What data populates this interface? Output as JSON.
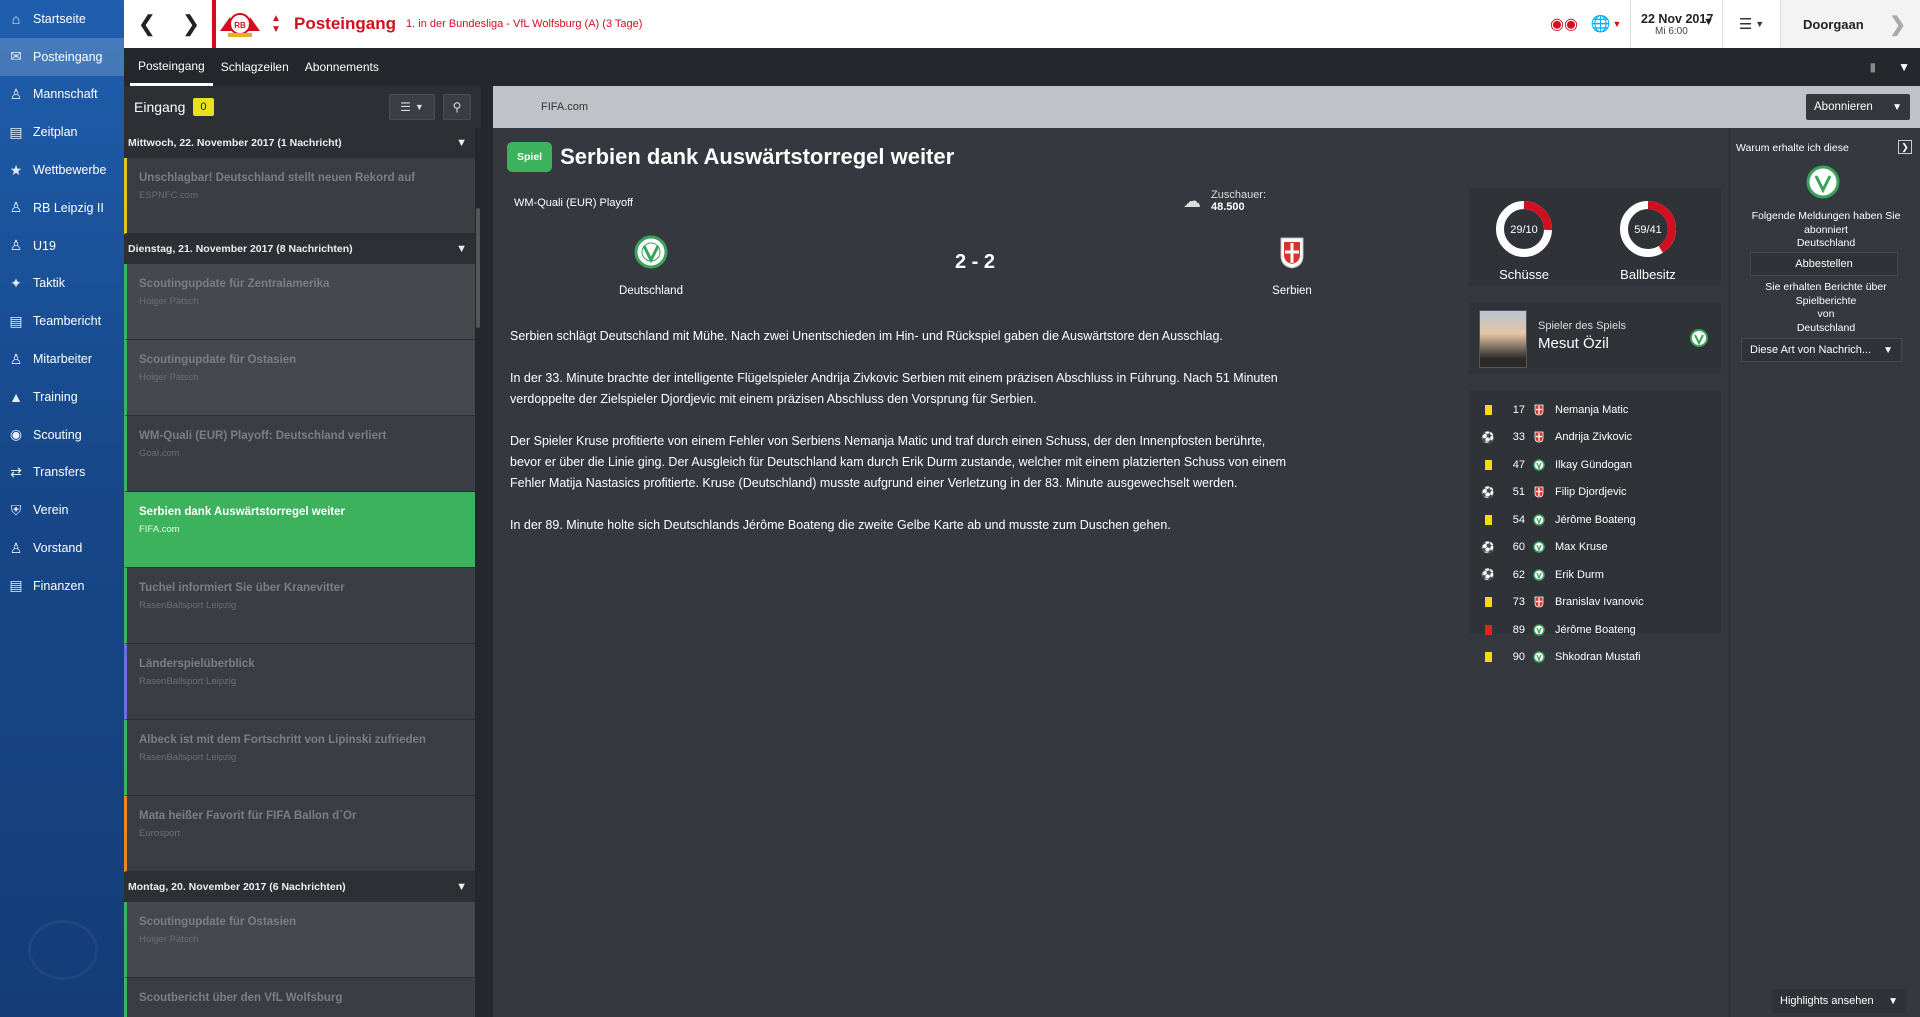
{
  "sidebar": {
    "items": [
      {
        "label": "Startseite",
        "icon": "home-icon"
      },
      {
        "label": "Posteingang",
        "icon": "inbox-icon"
      },
      {
        "label": "Mannschaft",
        "icon": "squad-icon"
      },
      {
        "label": "Zeitplan",
        "icon": "schedule-icon"
      },
      {
        "label": "Wettbewerbe",
        "icon": "trophy-icon"
      },
      {
        "label": "RB Leipzig II",
        "icon": "reserve-team-icon"
      },
      {
        "label": "U19",
        "icon": "youth-team-icon"
      },
      {
        "label": "Taktik",
        "icon": "tactics-icon"
      },
      {
        "label": "Teambericht",
        "icon": "report-icon"
      },
      {
        "label": "Mitarbeiter",
        "icon": "staff-icon"
      },
      {
        "label": "Training",
        "icon": "training-icon"
      },
      {
        "label": "Scouting",
        "icon": "binoculars-icon"
      },
      {
        "label": "Transfers",
        "icon": "transfers-icon"
      },
      {
        "label": "Verein",
        "icon": "club-icon"
      },
      {
        "label": "Vorstand",
        "icon": "board-icon"
      },
      {
        "label": "Finanzen",
        "icon": "finances-icon"
      }
    ]
  },
  "topbar": {
    "title": "Posteingang",
    "next_match": "1. in der Bundesliga - VfL Wolfsburg (A) (3 Tage)",
    "date": "22 Nov 2017",
    "day_time": "Mi 6:00",
    "continue_label": "Doorgaan",
    "accent_color": "#d20f1e"
  },
  "subnav": {
    "tabs": [
      "Posteingang",
      "Schlagzeilen",
      "Abonnements"
    ]
  },
  "inbox": {
    "title": "Eingang",
    "unread_count": "0",
    "groups": [
      {
        "header": "Mittwoch, 22. November 2017 (1 Nachricht)",
        "messages": [
          {
            "title": "Unschlagbar! Deutschland stellt neuen Rekord auf",
            "source": "ESPNFC.com",
            "color": "#e8c21e",
            "lighter": false
          }
        ]
      },
      {
        "header": "Dienstag, 21. November 2017 (8 Nachrichten)",
        "messages": [
          {
            "title": "Scoutingupdate für Zentralamerika",
            "source": "Holger Pätsch",
            "color": "#3bb25b",
            "lighter": true
          },
          {
            "title": "Scoutingupdate für Ostasien",
            "source": "Holger Pätsch",
            "color": "#3bb25b",
            "lighter": true
          },
          {
            "title": "WM-Quali (EUR) Playoff: Deutschland verliert",
            "source": "Goal.com",
            "color": "#3bb25b",
            "lighter": false
          },
          {
            "title": "Serbien dank Auswärtstorregel weiter",
            "source": "FIFA.com",
            "color": "#3bb25b",
            "lighter": false,
            "selected": true
          },
          {
            "title": "Tuchel informiert Sie über Kranevitter",
            "source": "RasenBallsport Leipzig",
            "color": "#3bb25b",
            "lighter": false
          },
          {
            "title": "Länderspielüberblick",
            "source": "RasenBallsport Leipzig",
            "color": "#6a6fd8",
            "lighter": false
          },
          {
            "title": "Albeck ist mit dem Fortschritt von Lipinski zufrieden",
            "source": "RasenBallsport Leipzig",
            "color": "#3bb25b",
            "lighter": false
          },
          {
            "title": "Mata heißer Favorit für FIFA Ballon d´Or",
            "source": "Eurosport",
            "color": "#e8881e",
            "lighter": false
          }
        ]
      },
      {
        "header": "Montag, 20. November 2017 (6 Nachrichten)",
        "messages": [
          {
            "title": "Scoutingupdate für Ostasien",
            "source": "Holger Pätsch",
            "color": "#3bb25b",
            "lighter": true
          },
          {
            "title": "Scoutbericht über den VfL Wolfsburg",
            "source": "",
            "color": "#3bb25b",
            "lighter": false
          }
        ]
      }
    ]
  },
  "content": {
    "source": "FIFA.com",
    "subscribe_label": "Abonnieren",
    "badge": "Spiel",
    "title": "Serbien dank Auswärtstorregel weiter",
    "competition": "WM-Quali (EUR) Playoff",
    "spectators_label": "Zuschauer:",
    "spectators_value": "48.500",
    "home_team": "Deutschland",
    "away_team": "Serbien",
    "score": "2 - 2",
    "paragraphs": [
      "Serbien schlägt Deutschland mit Mühe. Nach zwei Unentschieden im Hin- und Rückspiel gaben die Auswärtstore den Ausschlag.",
      "In der 33. Minute brachte der intelligente Flügelspieler Andrija Zivkovic Serbien mit einem präzisen Abschluss in Führung. Nach 51 Minuten verdoppelte der Zielspieler Djordjevic mit einem präzisen Abschluss den Vorsprung für Serbien.",
      "Der Spieler Kruse profitierte von einem Fehler von Serbiens Nemanja Matic und traf durch einen Schuss, der den Innenpfosten berührte, bevor er über die Linie ging. Der Ausgleich für Deutschland kam durch Erik Durm zustande, welcher mit einem platzierten Schuss von einem Fehler Matija Nastasics profitierte. Kruse (Deutschland) musste aufgrund einer Verletzung in der 83. Minute ausgewechselt werden.",
      "In der 89. Minute holte sich Deutschlands Jérôme Boateng die zweite Gelbe Karte ab und musste zum Duschen gehen."
    ],
    "stats": {
      "shots_label": "Schüsse",
      "shots_value": "29/10",
      "shots_share": 0.744,
      "possession_label": "Ballbesitz",
      "possession_value": "59/41",
      "possession_share": 0.59
    },
    "motm": {
      "label": "Spieler des Spiels",
      "name": "Mesut Özil"
    },
    "events": [
      {
        "type": "yellow",
        "minute": "17",
        "team": "serbia",
        "player": "Nemanja Matic"
      },
      {
        "type": "goal",
        "minute": "33",
        "team": "serbia",
        "player": "Andrija Zivkovic"
      },
      {
        "type": "yellow",
        "minute": "47",
        "team": "germany",
        "player": "Ilkay Gündogan"
      },
      {
        "type": "goal",
        "minute": "51",
        "team": "serbia",
        "player": "Filip Djordjevic"
      },
      {
        "type": "yellow",
        "minute": "54",
        "team": "germany",
        "player": "Jérôme Boateng"
      },
      {
        "type": "goal",
        "minute": "60",
        "team": "germany",
        "player": "Max Kruse"
      },
      {
        "type": "goal",
        "minute": "62",
        "team": "germany",
        "player": "Erik Durm"
      },
      {
        "type": "yellow",
        "minute": "73",
        "team": "serbia",
        "player": "Branislav Ivanovic"
      },
      {
        "type": "red",
        "minute": "89",
        "team": "germany",
        "player": "Jérôme Boateng"
      },
      {
        "type": "yellow",
        "minute": "90",
        "team": "germany",
        "player": "Shkodran Mustafi"
      }
    ],
    "colors": {
      "selected": "#3bb25b",
      "yellow_card": "#f2dd00",
      "red_card": "#e0241f",
      "germany": "#3aa35b",
      "serbia": "#d8342f"
    }
  },
  "rightpanel": {
    "title": "Warum erhalte ich diese",
    "subscribed_text": "Folgende Meldungen haben Sie abonniert",
    "subscribed_team": "Deutschland",
    "unsubscribe_label": "Abbestellen",
    "reports_text": "Sie erhalten Berichte über Spielberichte",
    "reports_from": "von",
    "reports_team": "Deutschland",
    "select_label": "Diese Art von Nachrich..."
  },
  "footer": {
    "highlights_label": "Highlights ansehen"
  }
}
